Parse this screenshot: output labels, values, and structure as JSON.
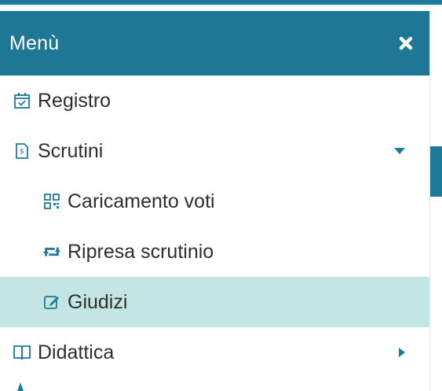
{
  "menu": {
    "title": "Menù",
    "items": [
      {
        "label": "Registro",
        "icon": "calendar-check-icon"
      },
      {
        "label": "Scrutini",
        "icon": "document-scrutini-icon",
        "caret": "chevron-down-icon"
      },
      {
        "label": "Caricamento voti",
        "icon": "qr-grid-icon",
        "sub": true
      },
      {
        "label": "Ripresa scrutinio",
        "icon": "retweet-icon",
        "sub": true
      },
      {
        "label": "Giudizi",
        "icon": "edit-icon",
        "sub": true,
        "active": true
      },
      {
        "label": "Didattica",
        "icon": "open-book-icon",
        "caret": "chevron-right-icon"
      }
    ]
  },
  "colors": {
    "header": "#1f7796",
    "active_bg": "#c3e6e3",
    "accent": "#1e7a9b",
    "text": "#2e2e2e"
  }
}
